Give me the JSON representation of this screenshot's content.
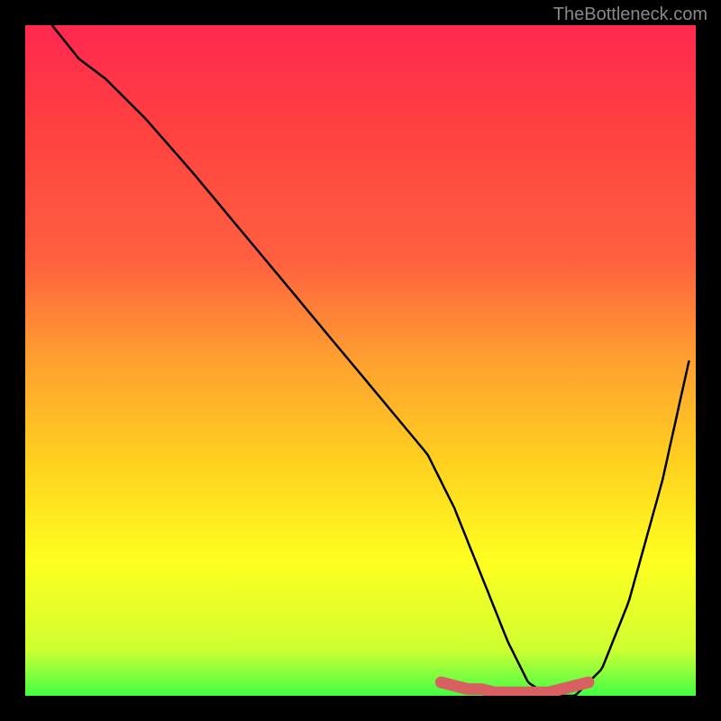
{
  "watermark": "TheBottleneck.com",
  "chart_data": {
    "type": "line",
    "title": "",
    "xlabel": "",
    "ylabel": "",
    "xlim": [
      0,
      100
    ],
    "ylim": [
      0,
      100
    ],
    "gradient_colors": {
      "top": "#ff2850",
      "mid1": "#ff6040",
      "mid2": "#ffa030",
      "mid3": "#ffd020",
      "mid4": "#ffff20",
      "bottom": "#40ff40"
    },
    "series": [
      {
        "name": "bottleneck-curve",
        "color": "#000000",
        "x": [
          4,
          8,
          12,
          18,
          25,
          35,
          45,
          55,
          60,
          64,
          68,
          72,
          75,
          78,
          82,
          86,
          90,
          95,
          99
        ],
        "y": [
          100,
          95,
          92,
          86,
          78,
          66,
          54,
          42,
          36,
          28,
          18,
          8,
          2,
          0,
          0,
          4,
          14,
          32,
          50
        ]
      }
    ],
    "highlight_segment": {
      "name": "optimal-range",
      "color": "#d86060",
      "x": [
        62,
        64,
        66,
        68,
        70,
        72,
        74,
        76,
        78,
        80,
        82,
        84
      ],
      "y": [
        2,
        1.5,
        1,
        1,
        0.5,
        0.5,
        0.5,
        0.5,
        0.5,
        1,
        1.5,
        2
      ]
    }
  }
}
